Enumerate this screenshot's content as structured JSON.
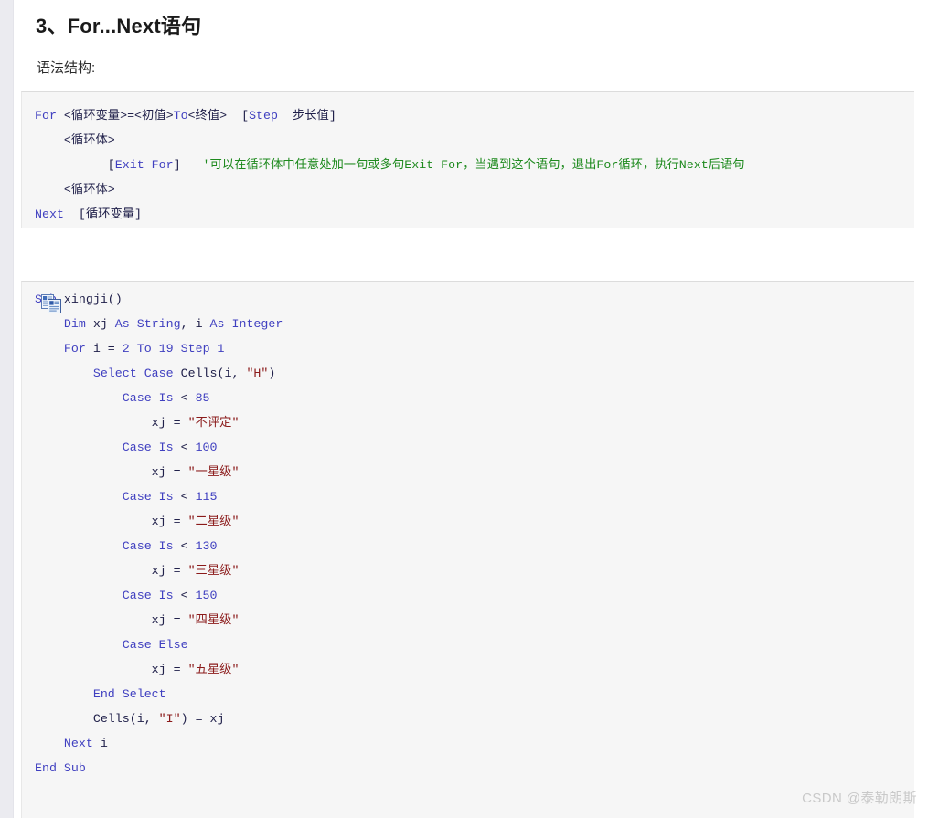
{
  "page": {
    "title": "3、For...Next语句",
    "syntax_label": "语法结构:",
    "watermark": "CSDN @泰勒朗斯"
  },
  "syntax_block": {
    "icon": "code-block",
    "lines": [
      [
        {
          "t": "For ",
          "c": "kw"
        },
        {
          "t": "<循环变量>=<初值>",
          "c": "txt"
        },
        {
          "t": "To",
          "c": "kw"
        },
        {
          "t": "<终值>  ",
          "c": "txt"
        },
        {
          "t": "[",
          "c": "txt"
        },
        {
          "t": "Step",
          "c": "kw"
        },
        {
          "t": "  步长值]",
          "c": "txt"
        }
      ],
      [
        {
          "t": "    <循环体>",
          "c": "txt"
        }
      ],
      [
        {
          "t": "          [",
          "c": "txt"
        },
        {
          "t": "Exit For",
          "c": "kw"
        },
        {
          "t": "]   ",
          "c": "txt"
        },
        {
          "t": "'可以在循环体中任意处加一句或多句Exit For，当遇到这个语句，退出For循环，执行Next后语句",
          "c": "cmt"
        }
      ],
      [
        {
          "t": "    <循环体>",
          "c": "txt"
        }
      ],
      [
        {
          "t": "Next",
          "c": "kw"
        },
        {
          "t": "  [循环变量]",
          "c": "txt"
        }
      ]
    ]
  },
  "example_block": {
    "copy_button_label": "copy-icon",
    "lines": [
      [
        {
          "t": "Sub ",
          "c": "kw"
        },
        {
          "t": "xingji()",
          "c": "pln"
        }
      ],
      [
        {
          "t": "    ",
          "c": "pln"
        },
        {
          "t": "Dim ",
          "c": "kw"
        },
        {
          "t": "xj ",
          "c": "pln"
        },
        {
          "t": "As String",
          "c": "kw"
        },
        {
          "t": ", i ",
          "c": "pln"
        },
        {
          "t": "As Integer",
          "c": "kw"
        }
      ],
      [
        {
          "t": "    ",
          "c": "pln"
        },
        {
          "t": "For ",
          "c": "kw"
        },
        {
          "t": "i = ",
          "c": "pln"
        },
        {
          "t": "2 ",
          "c": "num"
        },
        {
          "t": "To ",
          "c": "kw"
        },
        {
          "t": "19 ",
          "c": "num"
        },
        {
          "t": "Step ",
          "c": "kw"
        },
        {
          "t": "1",
          "c": "num"
        }
      ],
      [
        {
          "t": "        ",
          "c": "pln"
        },
        {
          "t": "Select Case ",
          "c": "kw"
        },
        {
          "t": "Cells(i, ",
          "c": "pln"
        },
        {
          "t": "\"H\"",
          "c": "str"
        },
        {
          "t": ")",
          "c": "pln"
        }
      ],
      [
        {
          "t": "            ",
          "c": "pln"
        },
        {
          "t": "Case Is ",
          "c": "kw"
        },
        {
          "t": "< ",
          "c": "pln"
        },
        {
          "t": "85",
          "c": "num"
        }
      ],
      [
        {
          "t": "                xj = ",
          "c": "pln"
        },
        {
          "t": "\"不评定\"",
          "c": "str"
        }
      ],
      [
        {
          "t": "            ",
          "c": "pln"
        },
        {
          "t": "Case Is ",
          "c": "kw"
        },
        {
          "t": "< ",
          "c": "pln"
        },
        {
          "t": "100",
          "c": "num"
        }
      ],
      [
        {
          "t": "                xj = ",
          "c": "pln"
        },
        {
          "t": "\"一星级\"",
          "c": "str"
        }
      ],
      [
        {
          "t": "            ",
          "c": "pln"
        },
        {
          "t": "Case Is ",
          "c": "kw"
        },
        {
          "t": "< ",
          "c": "pln"
        },
        {
          "t": "115",
          "c": "num"
        }
      ],
      [
        {
          "t": "                xj = ",
          "c": "pln"
        },
        {
          "t": "\"二星级\"",
          "c": "str"
        }
      ],
      [
        {
          "t": "            ",
          "c": "pln"
        },
        {
          "t": "Case Is ",
          "c": "kw"
        },
        {
          "t": "< ",
          "c": "pln"
        },
        {
          "t": "130",
          "c": "num"
        }
      ],
      [
        {
          "t": "                xj = ",
          "c": "pln"
        },
        {
          "t": "\"三星级\"",
          "c": "str"
        }
      ],
      [
        {
          "t": "            ",
          "c": "pln"
        },
        {
          "t": "Case Is ",
          "c": "kw"
        },
        {
          "t": "< ",
          "c": "pln"
        },
        {
          "t": "150",
          "c": "num"
        }
      ],
      [
        {
          "t": "                xj = ",
          "c": "pln"
        },
        {
          "t": "\"四星级\"",
          "c": "str"
        }
      ],
      [
        {
          "t": "            ",
          "c": "pln"
        },
        {
          "t": "Case Else",
          "c": "kw"
        }
      ],
      [
        {
          "t": "                xj = ",
          "c": "pln"
        },
        {
          "t": "\"五星级\"",
          "c": "str"
        }
      ],
      [
        {
          "t": "        ",
          "c": "pln"
        },
        {
          "t": "End Select",
          "c": "kw"
        }
      ],
      [
        {
          "t": "        Cells(i, ",
          "c": "pln"
        },
        {
          "t": "\"I\"",
          "c": "str"
        },
        {
          "t": ") = xj",
          "c": "pln"
        }
      ],
      [
        {
          "t": "    ",
          "c": "pln"
        },
        {
          "t": "Next ",
          "c": "kw"
        },
        {
          "t": "i",
          "c": "pln"
        }
      ],
      [
        {
          "t": "End Sub",
          "c": "kw"
        }
      ]
    ]
  },
  "colors": {
    "keyword": "#4040c0",
    "string": "#8b1a1a",
    "comment": "#1e8a1e",
    "plain": "#20204a",
    "code_bg": "#f6f6f6",
    "page_bg": "#ffffff",
    "gutter": "#ebebf0",
    "watermark": "#c9c9c9"
  }
}
